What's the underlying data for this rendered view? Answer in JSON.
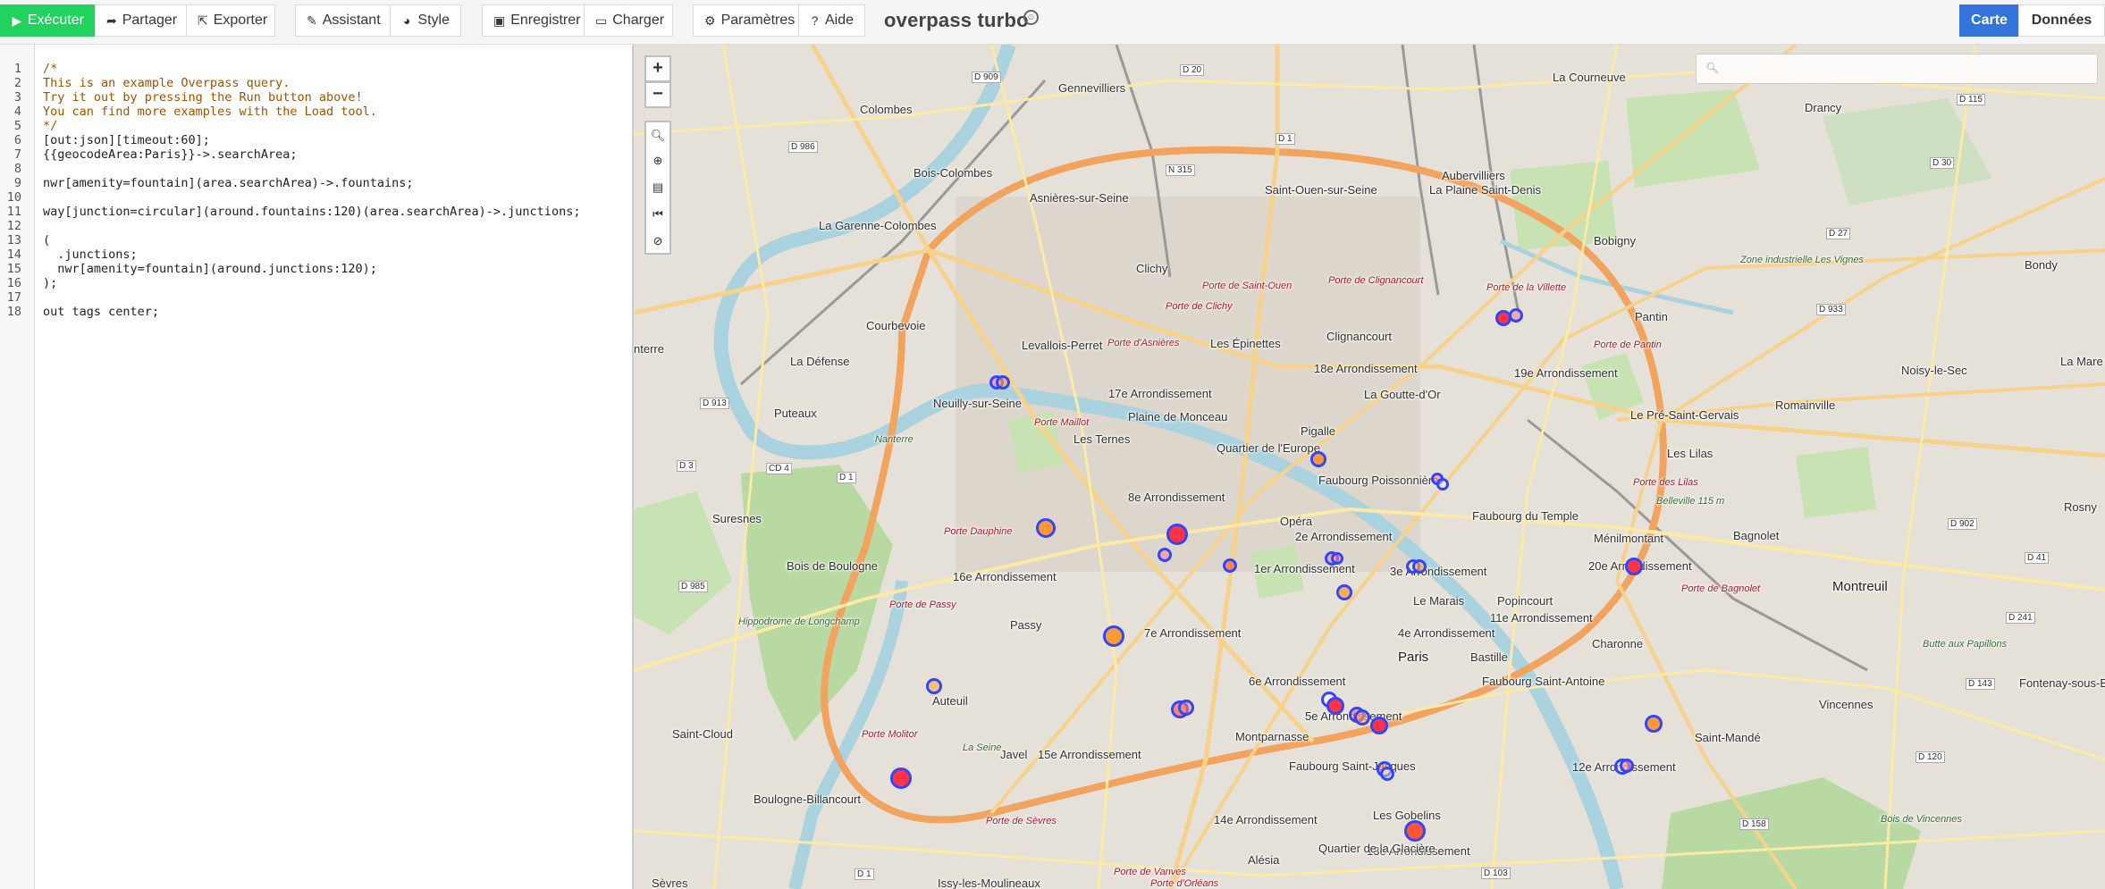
{
  "toolbar": {
    "execute": "Exécuter",
    "share": "Partager",
    "export": "Exporter",
    "wizard": "Assistant",
    "style": "Style",
    "save": "Enregistrer",
    "load": "Charger",
    "settings": "Paramètres",
    "help": "Aide",
    "brand": "overpass turbo",
    "tab_map": "Carte",
    "tab_data": "Données"
  },
  "editor": {
    "line_numbers": [
      "1",
      "2",
      "3",
      "4",
      "5",
      "6",
      "7",
      "8",
      "9",
      "10",
      "11",
      "12",
      "13",
      "14",
      "15",
      "16",
      "17",
      "18"
    ],
    "lines": [
      "/*",
      "This is an example Overpass query.",
      "Try it out by pressing the Run button above!",
      "You can find more examples with the Load tool.",
      "*/",
      "[out:json][timeout:60];",
      "{{geocodeArea:Paris}}->.searchArea;",
      "",
      "nwr[amenity=fountain](area.searchArea)->.fountains;",
      "",
      "way[junction=circular](around.fountains:120)(area.searchArea)->.junctions;",
      "",
      "(",
      "  .junctions;",
      "  nwr[amenity=fountain](around.junctions:120);",
      ");",
      "",
      "out tags center;"
    ]
  },
  "map": {
    "zoom_in": "+",
    "zoom_out": "−",
    "search_placeholder": "",
    "labels": {
      "colombes": "Colombes",
      "gennevilliers": "Gennevilliers",
      "la_courneuve": "La Courneuve",
      "drancy": "Drancy",
      "bois_colombes": "Bois-Colombes",
      "asnieres": "Asnières-sur-Seine",
      "aubervilliers": "Aubervilliers",
      "saint_ouen": "Saint-Ouen-sur-Seine",
      "plaine_saint_denis": "La Plaine Saint-Denis",
      "bobigny": "Bobigny",
      "bondy": "Bondy",
      "garenne": "La Garenne-Colombes",
      "clichy": "Clichy",
      "courbevoie": "Courbevoie",
      "pantin": "Pantin",
      "levallois": "Levallois-Perret",
      "epinettes": "Les Épinettes",
      "clignancourt": "Clignancourt",
      "arr18": "18e Arrondissement",
      "arr19": "19e Arrondissement",
      "la_defense": "La Défense",
      "puteaux": "Puteaux",
      "neuilly": "Neuilly-sur-Seine",
      "arr17": "17e Arrondissement",
      "plaine_monceau": "Plaine de Monceau",
      "goutte_dor": "La Goutte-d'Or",
      "pre_saint_gervais": "Le Pré-Saint-Gervais",
      "romainville": "Romainville",
      "noisy": "Noisy-le-Sec",
      "ternes": "Les Ternes",
      "quartier_europe": "Quartier de l'Europe",
      "pigalle": "Pigalle",
      "faubourg_poissonniere": "Faubourg Poissonnière",
      "les_lilas": "Les Lilas",
      "suresnes": "Suresnes",
      "arr8": "8e Arrondissement",
      "opera": "Opéra",
      "faubourg_temple": "Faubourg du Temple",
      "menilmontant": "Ménilmontant",
      "bagnolet": "Bagnolet",
      "arr2": "2e Arrondissement",
      "arr16": "16e Arrondissement",
      "bois_boulogne": "Bois de Boulogne",
      "arr1": "1er Arrondissement",
      "arr3": "3e Arrondissement",
      "arr20": "20e Arrondissement",
      "montreuil": "Montreuil",
      "le_marais": "Le Marais",
      "popincourt": "Popincourt",
      "arr11": "11e Arrondissement",
      "passy": "Passy",
      "arr7": "7e Arrondissement",
      "arr4": "4e Arrondissement",
      "paris": "Paris",
      "charonne": "Charonne",
      "bastille": "Bastille",
      "auteuil": "Auteuil",
      "arr6": "6e Arrondissement",
      "faubourg_saint_antoine": "Faubourg Saint-Antoine",
      "vincennes": "Vincennes",
      "fontenay": "Fontenay-sous-Bois",
      "saint_cloud": "Saint-Cloud",
      "arr5": "5e Arrondissement",
      "saint_mande": "Saint-Mandé",
      "montparnasse": "Montparnasse",
      "javel": "Javel",
      "arr15": "15e Arrondissement",
      "arr12": "12e Arrondissement",
      "faubourg_saint_jacques": "Faubourg Saint-Jacques",
      "boulogne": "Boulogne-Billancourt",
      "les_gobelins": "Les Gobelins",
      "arr14": "14e Arrondissement",
      "arr13": "13e Arrondissement",
      "bois_vincennes": "Bois de Vincennes",
      "alesia": "Alésia",
      "quartier_glaciere": "Quartier de la Glacière",
      "issy": "Issy-les-Moulineaux",
      "sevres": "Sèvres",
      "la_mare": "La Mare",
      "rosny": "Rosny",
      "zone_vignes": "Zone industrielle Les Vignes",
      "butte_papillons": "Butte aux Papillons",
      "belleville": "Belleville 115 m",
      "hippodrome": "Hippodrome de Longchamp",
      "porte_saint_ouen": "Porte de Saint-Ouen",
      "porte_clignancourt": "Porte de Clignancourt",
      "porte_villette": "Porte de la Villette",
      "porte_clichy": "Porte de Clichy",
      "porte_asnieres": "Porte d'Asnières",
      "porte_pantin": "Porte de Pantin",
      "porte_maillot": "Porte Maillot",
      "porte_dauphine": "Porte Dauphine",
      "porte_lilas": "Porte des Lilas",
      "porte_bagnolet": "Porte de Bagnolet",
      "porte_passy": "Porte de Passy",
      "porte_molitor": "Porte Molitor",
      "porte_sevres": "Porte de Sèvres",
      "porte_vanves": "Porte de Vanves",
      "porte_orleans": "Porte d'Orléans",
      "nanterre": "Nanterre",
      "la_seine": "La Seine",
      "terre": "nterre",
      "road_d909": "D 909",
      "road_d20": "D 20",
      "road_d986": "D 986",
      "road_d1": "D 1",
      "road_n315": "N 315",
      "road_d115": "D 115",
      "road_d30": "D 30",
      "road_d27": "D 27",
      "road_d933": "D 933",
      "road_d913": "D 913",
      "road_d3": "D 3",
      "road_cd4": "CD 4",
      "road_d985": "D 985",
      "road_d902": "D 902",
      "road_d41": "D 41",
      "road_d241": "D 241",
      "road_d143": "D 143",
      "road_d120": "D 120",
      "road_d158": "D 158",
      "road_d103": "D 103",
      "road_d1b": "D 1"
    }
  }
}
